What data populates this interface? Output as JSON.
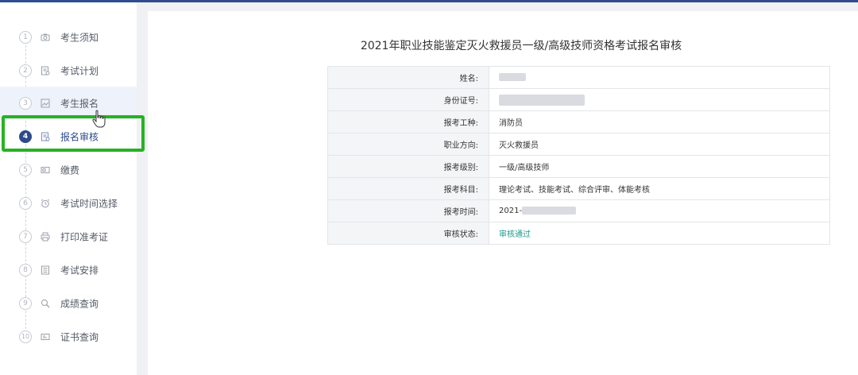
{
  "sidebar": {
    "steps": [
      {
        "num": "1",
        "label": "考生须知",
        "icon": "camera-icon"
      },
      {
        "num": "2",
        "label": "考试计划",
        "icon": "document-icon"
      },
      {
        "num": "3",
        "label": "考生报名",
        "icon": "image-icon"
      },
      {
        "num": "4",
        "label": "报名审核",
        "icon": "document-check-icon"
      },
      {
        "num": "5",
        "label": "缴费",
        "icon": "wallet-icon"
      },
      {
        "num": "6",
        "label": "考试时间选择",
        "icon": "alarm-clock-icon"
      },
      {
        "num": "7",
        "label": "打印准考证",
        "icon": "printer-icon"
      },
      {
        "num": "8",
        "label": "考试安排",
        "icon": "list-icon"
      },
      {
        "num": "9",
        "label": "成绩查询",
        "icon": "search-icon"
      },
      {
        "num": "10",
        "label": "证书查询",
        "icon": "card-icon"
      }
    ],
    "active_step": "4"
  },
  "main": {
    "title": "2021年职业技能鉴定灭火救援员一级/高级技师资格考试报名审核",
    "rows": [
      {
        "label": "姓名:",
        "value": ""
      },
      {
        "label": "身份证号:",
        "value": ""
      },
      {
        "label": "报考工种:",
        "value": "消防员"
      },
      {
        "label": "职业方向:",
        "value": "灭火救援员"
      },
      {
        "label": "报考级别:",
        "value": "一级/高级技师"
      },
      {
        "label": "报考科目:",
        "value": "理论考试、技能考试、综合评审、体能考核"
      },
      {
        "label": "报考时间:",
        "value": "2021-"
      },
      {
        "label": "审核状态:",
        "value": "审核通过"
      }
    ]
  },
  "colors": {
    "accent": "#2d4a8a",
    "highlight_box": "#27b224",
    "status_pass": "#1d9a8e"
  }
}
